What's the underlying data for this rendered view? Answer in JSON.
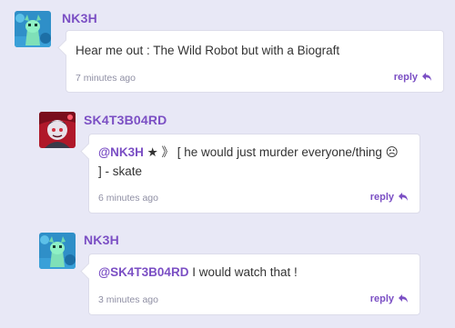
{
  "comments": [
    {
      "username": "NK3H",
      "text": "Hear me out : The Wild Robot but with a Biograft",
      "time": "7 minutes ago",
      "reply_label": "reply"
    },
    {
      "username": "SK4T3B04RD",
      "mention": "@NK3H",
      "line1": " ★ 》    [ he would just murder everyone/thing ☹",
      "line2": "]    - skate",
      "time": "6 minutes ago",
      "reply_label": "reply"
    },
    {
      "username": "NK3H",
      "mention": "@SK4T3B04RD",
      "text": " I would watch that !",
      "time": "3 minutes ago",
      "reply_label": "reply"
    }
  ],
  "icons": {
    "avatar_nk3h": "avatar-robot-image",
    "avatar_sk4t3b04rd": "avatar-red-character-image",
    "reply": "reply-arrow-icon"
  },
  "colors": {
    "background": "#e8e8f6",
    "username": "#7b4fc4",
    "text": "#333333",
    "time": "#8f8fa4"
  }
}
